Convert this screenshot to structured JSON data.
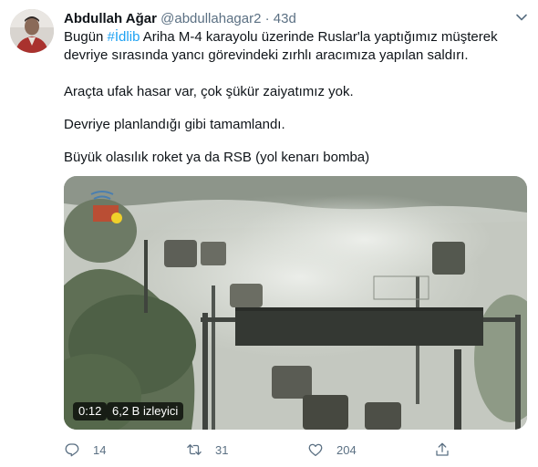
{
  "tweet": {
    "author_name": "Abdullah Ağar",
    "author_handle": "@abdullahagar2",
    "separator": "·",
    "timestamp": "43d",
    "text_line1_prefix": "Bugün ",
    "hashtag": "#İdlib",
    "text_line1_suffix": " Ariha M-4 karayolu üzerinde Ruslar'la yaptığımız müşterek",
    "text_line2": "devriye sırasında yancı görevindeki zırhlı aracımıza yapılan saldırı.",
    "paragraph2": "Araçta ufak hasar var, çok şükür zaiyatımız yok.",
    "paragraph3": "Devriye planlandığı gibi tamamlandı.",
    "paragraph4": "Büyük olasılık roket ya da RSB (yol kenarı bomba)"
  },
  "video": {
    "duration": "0:12",
    "views": "6,2 B izleyici"
  },
  "actions": {
    "reply_count": "14",
    "retweet_count": "31",
    "like_count": "204"
  },
  "icons": {
    "reply": "reply-icon",
    "retweet": "retweet-icon",
    "like": "heart-icon",
    "share": "share-icon",
    "more": "chevron-down-icon"
  },
  "colors": {
    "accent": "#1da1f2",
    "secondary_text": "#5b7083",
    "primary_text": "#0f1419"
  }
}
